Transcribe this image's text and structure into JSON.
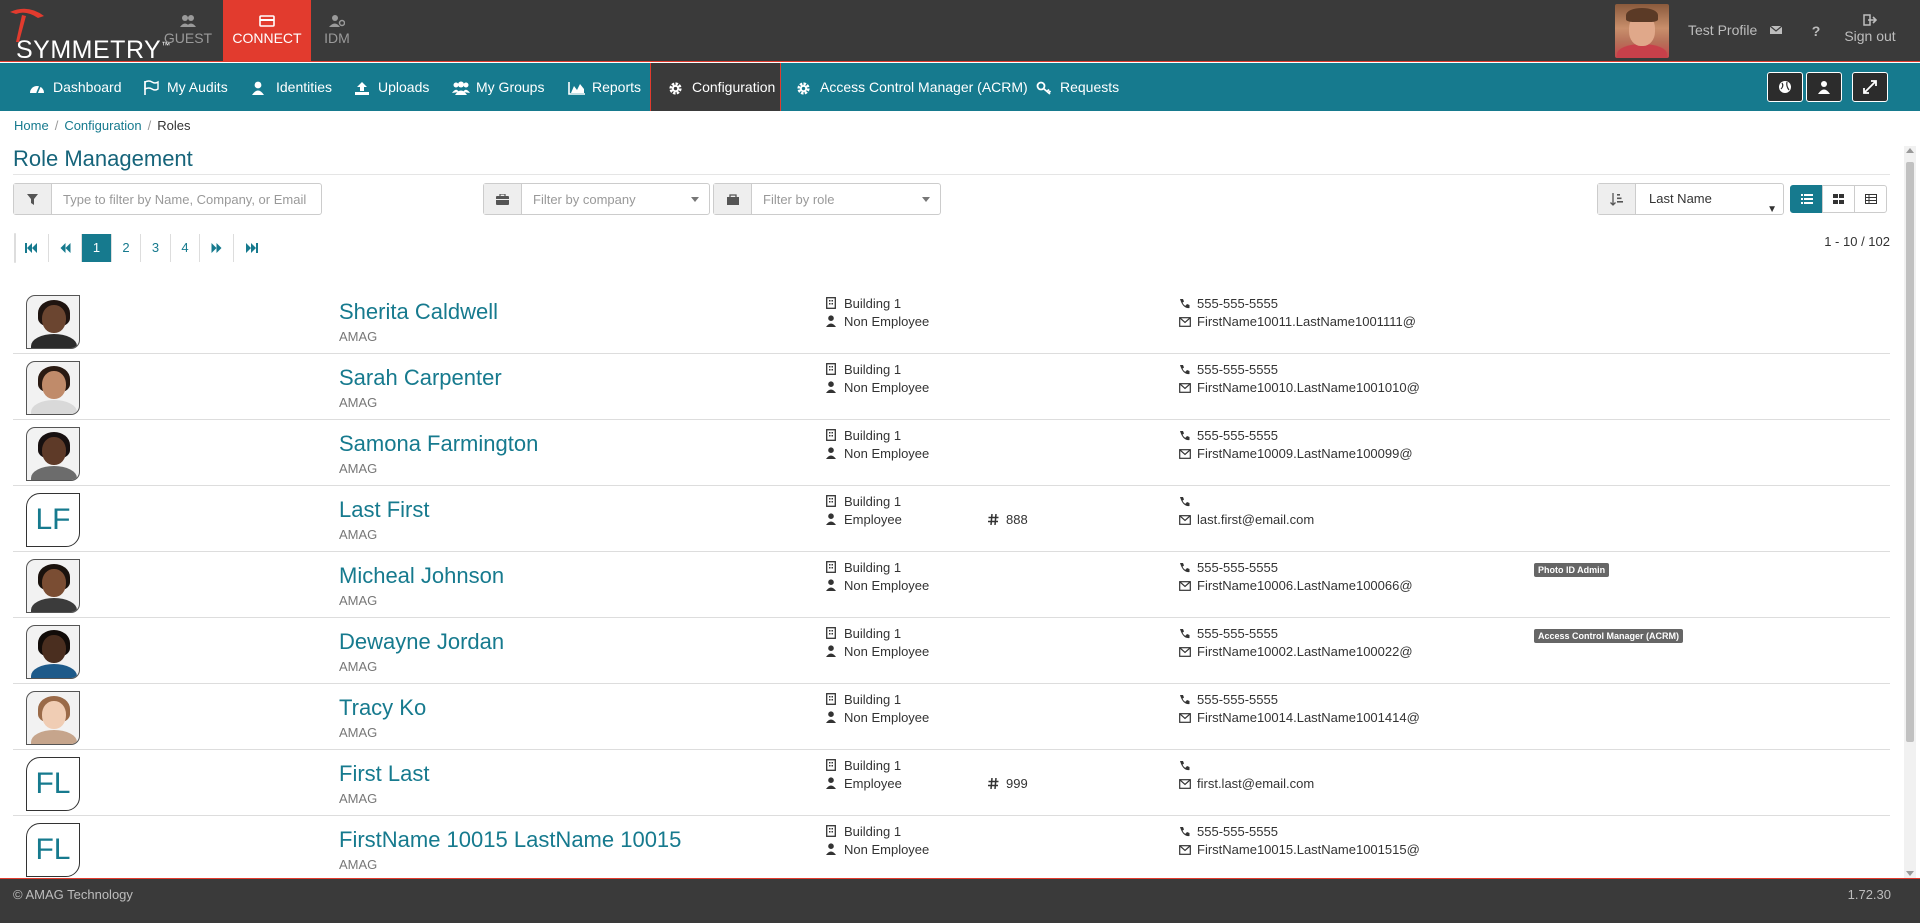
{
  "app": {
    "logo_text": "SYMMETRY",
    "logo_tm": "™",
    "tabs": [
      {
        "label": "GUEST",
        "icon": "users-icon",
        "active": false
      },
      {
        "label": "CONNECT",
        "icon": "id-card-icon",
        "active": true
      },
      {
        "label": "IDM",
        "icon": "user-cog-icon",
        "active": false
      }
    ],
    "profile_name": "Test Profile",
    "sign_out": "Sign out"
  },
  "nav": {
    "items": [
      {
        "label": "Dashboard",
        "icon": "dashboard-icon"
      },
      {
        "label": "My Audits",
        "icon": "flag-icon"
      },
      {
        "label": "Identities",
        "icon": "user-icon"
      },
      {
        "label": "Uploads",
        "icon": "upload-icon"
      },
      {
        "label": "My Groups",
        "icon": "group-icon"
      },
      {
        "label": "Reports",
        "icon": "area-chart-icon"
      },
      {
        "label": "Configuration",
        "icon": "gear-icon",
        "active": true
      },
      {
        "label": "Access Control Manager (ACRM)",
        "icon": "gear-icon"
      },
      {
        "label": "Requests",
        "icon": "key-icon"
      }
    ]
  },
  "breadcrumb": {
    "home": "Home",
    "configuration": "Configuration",
    "current": "Roles",
    "sep": "/"
  },
  "page": {
    "title": "Role Management"
  },
  "filters": {
    "text_placeholder": "Type to filter by Name, Company, or Email",
    "company_placeholder": "Filter by company",
    "role_placeholder": "Filter by role",
    "sort_value": "Last Name"
  },
  "pager": {
    "pages": [
      "1",
      "2",
      "3",
      "4"
    ],
    "current": "1",
    "range": "1 - 10 / 102"
  },
  "people": [
    {
      "name": "Sherita Caldwell",
      "company": "AMAG",
      "building": "Building 1",
      "type": "Non Employee",
      "badge_no": "",
      "phone": "555-555-5555",
      "email": "FirstName10011.LastName1001111@",
      "role": "",
      "initials": "",
      "photo": {
        "skin": "#6b4530",
        "hair": "#1f1410",
        "body": "#2b2b2b"
      }
    },
    {
      "name": "Sarah Carpenter",
      "company": "AMAG",
      "building": "Building 1",
      "type": "Non Employee",
      "badge_no": "",
      "phone": "555-555-5555",
      "email": "FirstName10010.LastName1001010@",
      "role": "",
      "initials": "",
      "photo": {
        "skin": "#c08b6a",
        "hair": "#2a1a12",
        "body": "#d9d9d9"
      }
    },
    {
      "name": "Samona Farmington",
      "company": "AMAG",
      "building": "Building 1",
      "type": "Non Employee",
      "badge_no": "",
      "phone": "555-555-5555",
      "email": "FirstName10009.LastName100099@",
      "role": "",
      "initials": "",
      "photo": {
        "skin": "#5e3a28",
        "hair": "#171010",
        "body": "#6c6c6c"
      }
    },
    {
      "name": "Last First",
      "company": "AMAG",
      "building": "Building 1",
      "type": "Employee",
      "badge_no": "888",
      "phone": "",
      "email": "last.first@email.com",
      "role": "",
      "initials": "LF",
      "photo": null
    },
    {
      "name": "Micheal Johnson",
      "company": "AMAG",
      "building": "Building 1",
      "type": "Non Employee",
      "badge_no": "",
      "phone": "555-555-5555",
      "email": "FirstName10006.LastName100066@",
      "role": "Photo ID Admin",
      "initials": "",
      "photo": {
        "skin": "#7a4d33",
        "hair": "#1a120d",
        "body": "#3b3b3b"
      }
    },
    {
      "name": "Dewayne Jordan",
      "company": "AMAG",
      "building": "Building 1",
      "type": "Non Employee",
      "badge_no": "",
      "phone": "555-555-5555",
      "email": "FirstName10002.LastName100022@",
      "role": "Access Control Manager (ACRM)",
      "initials": "",
      "photo": {
        "skin": "#4a2e1f",
        "hair": "#120c09",
        "body": "#1d5a8a"
      }
    },
    {
      "name": "Tracy Ko",
      "company": "AMAG",
      "building": "Building 1",
      "type": "Non Employee",
      "badge_no": "",
      "phone": "555-555-5555",
      "email": "FirstName10014.LastName1001414@",
      "role": "",
      "initials": "",
      "photo": {
        "skin": "#f0cdb4",
        "hair": "#9a6a48",
        "body": "#c6a58c"
      }
    },
    {
      "name": "First Last",
      "company": "AMAG",
      "building": "Building 1",
      "type": "Employee",
      "badge_no": "999",
      "phone": "",
      "email": "first.last@email.com",
      "role": "",
      "initials": "FL",
      "photo": null
    },
    {
      "name": "FirstName 10015 LastName 10015",
      "company": "AMAG",
      "building": "Building 1",
      "type": "Non Employee",
      "badge_no": "",
      "phone": "555-555-5555",
      "email": "FirstName10015.LastName1001515@",
      "role": "",
      "initials": "FL",
      "photo": null
    }
  ],
  "footer": {
    "copyright": "© AMAG Technology",
    "version": "1.72.30"
  },
  "colors": {
    "brand_teal": "#167a8e",
    "brand_red": "#e23b2e",
    "dark_bar": "#3a3a3a"
  }
}
